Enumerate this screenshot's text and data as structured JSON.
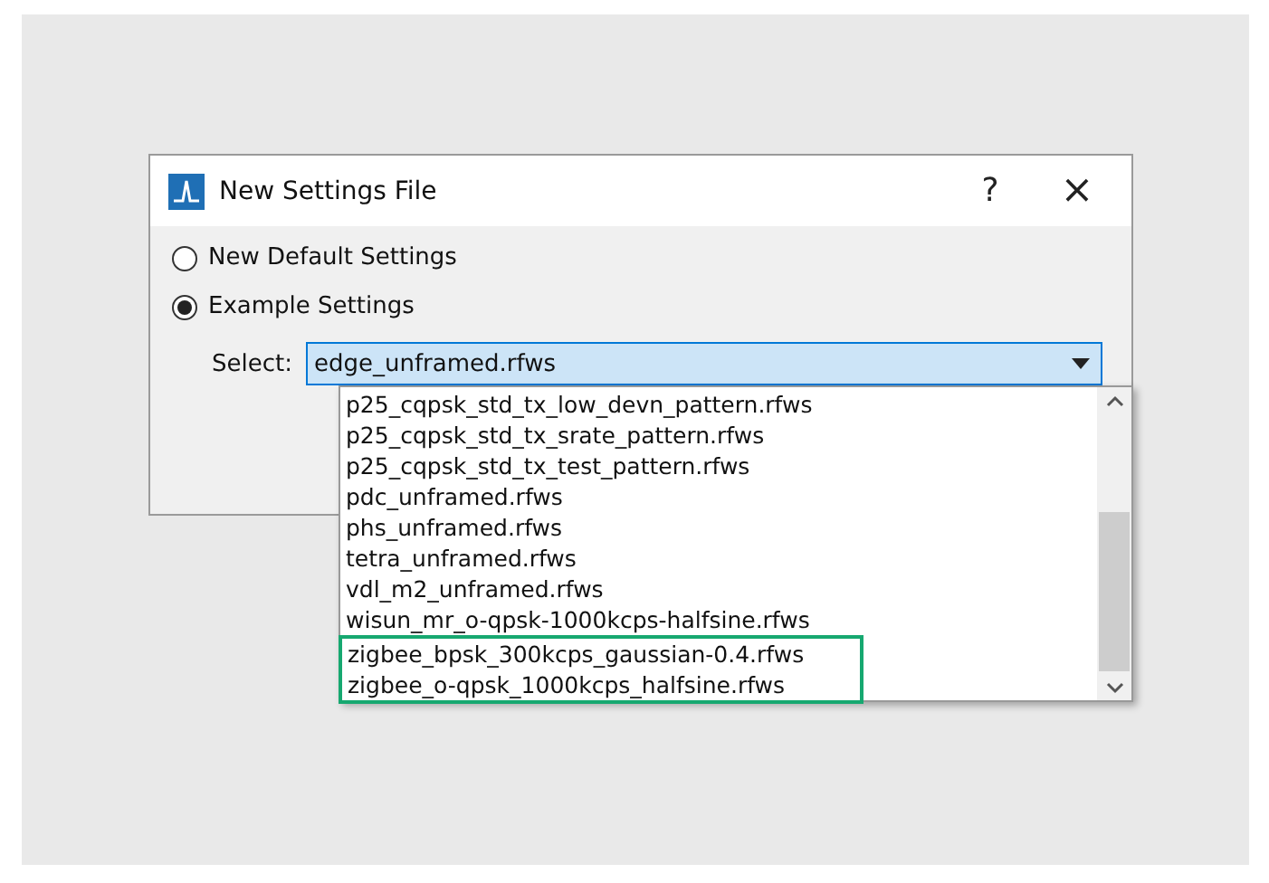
{
  "window": {
    "title": "New Settings File",
    "help": "?",
    "close": "×"
  },
  "options": [
    {
      "label": "New Default Settings",
      "selected": false
    },
    {
      "label": "Example Settings",
      "selected": true
    }
  ],
  "select": {
    "label": "Select:",
    "value": "edge_unframed.rfws",
    "expanded": true
  },
  "list": [
    {
      "label": "p25_cqpsk_std_tx_low_devn_pattern.rfws",
      "highlighted": false
    },
    {
      "label": "p25_cqpsk_std_tx_srate_pattern.rfws",
      "highlighted": false
    },
    {
      "label": "p25_cqpsk_std_tx_test_pattern.rfws",
      "highlighted": false
    },
    {
      "label": "pdc_unframed.rfws",
      "highlighted": false
    },
    {
      "label": "phs_unframed.rfws",
      "highlighted": false
    },
    {
      "label": "tetra_unframed.rfws",
      "highlighted": false
    },
    {
      "label": "vdl_m2_unframed.rfws",
      "highlighted": false
    },
    {
      "label": "wisun_mr_o-qpsk-1000kcps-halfsine.rfws",
      "highlighted": false
    },
    {
      "label": "zigbee_bpsk_300kcps_gaussian-0.4.rfws",
      "highlighted": true
    },
    {
      "label": "zigbee_o-qpsk_1000kcps_halfsine.rfws",
      "highlighted": true
    }
  ]
}
